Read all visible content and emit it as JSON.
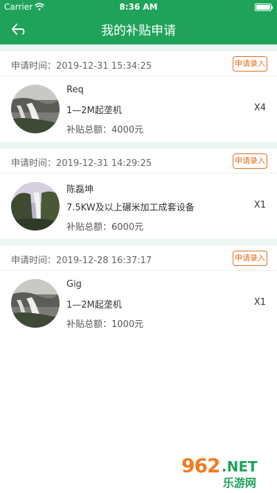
{
  "status_bar": {
    "carrier": "Carrier",
    "time": "8:36 AM"
  },
  "header": {
    "title": "我的补贴申请",
    "back_icon": "back-arrow-icon"
  },
  "apply_time_label": "申请时间：",
  "total_label": "补贴总额：",
  "entry_button_label": "申请录入",
  "colors": {
    "primary": "#1fa35a",
    "accent": "#e56a1a",
    "divider": "#eaf6f0"
  },
  "applications": [
    {
      "time": "2019-12-31 15:34:25",
      "name": "Req",
      "product": "1—2M起垄机",
      "qty": "X4",
      "amount": "4000元"
    },
    {
      "time": "2019-12-31 14:29:25",
      "name": "陈磊坤",
      "product": "7.5KW及以上碾米加工成套设备",
      "qty": "X1",
      "amount": "6000元"
    },
    {
      "time": "2019-12-28 16:37:17",
      "name": "Gig",
      "product": "1—2M起垄机",
      "qty": "X1",
      "amount": "1000元"
    }
  ],
  "watermark": {
    "brand": "962",
    "net": ".NET",
    "cn": "乐游网"
  }
}
